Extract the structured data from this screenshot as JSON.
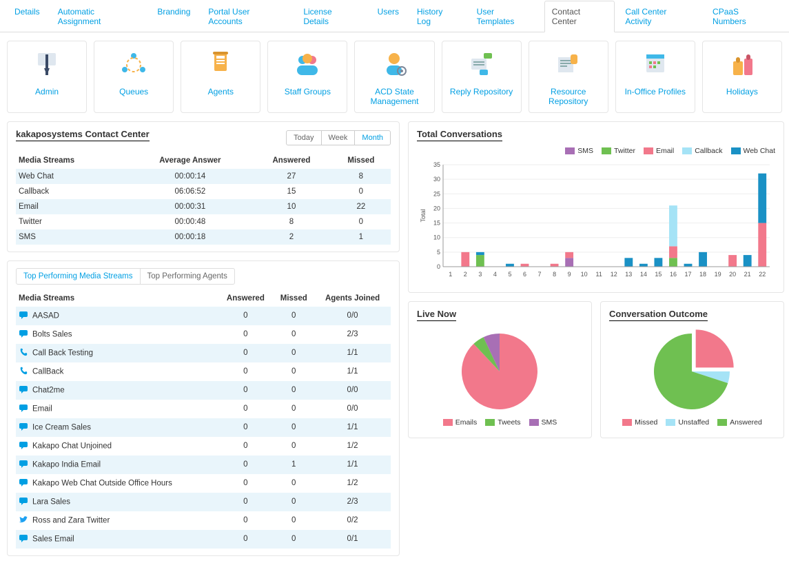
{
  "topTabs": [
    "Details",
    "Automatic Assignment",
    "Branding",
    "Portal User Accounts",
    "License Details",
    "Users",
    "History Log",
    "User Templates",
    "Contact Center",
    "Call Center Activity",
    "CPaaS Numbers"
  ],
  "topActive": 8,
  "cards": [
    {
      "label": "Admin",
      "icon": "admin"
    },
    {
      "label": "Queues",
      "icon": "queues"
    },
    {
      "label": "Agents",
      "icon": "agents"
    },
    {
      "label": "Staff Groups",
      "icon": "staff-groups"
    },
    {
      "label": "ACD State Management",
      "icon": "acd"
    },
    {
      "label": "Reply Repository",
      "icon": "reply-repo"
    },
    {
      "label": "Resource Repository",
      "icon": "resource-repo"
    },
    {
      "label": "In-Office Profiles",
      "icon": "profiles"
    },
    {
      "label": "Holidays",
      "icon": "holidays"
    }
  ],
  "summary": {
    "title": "kakaposystems Contact Center",
    "range": {
      "options": [
        "Today",
        "Week",
        "Month"
      ],
      "active": 2
    },
    "headers": [
      "Media Streams",
      "Average Answer",
      "Answered",
      "Missed"
    ],
    "rows": [
      {
        "name": "Web Chat",
        "avg": "00:00:14",
        "ans": "27",
        "miss": "8"
      },
      {
        "name": "Callback",
        "avg": "06:06:52",
        "ans": "15",
        "miss": "0"
      },
      {
        "name": "Email",
        "avg": "00:00:31",
        "ans": "10",
        "miss": "22"
      },
      {
        "name": "Twitter",
        "avg": "00:00:48",
        "ans": "8",
        "miss": "0"
      },
      {
        "name": "SMS",
        "avg": "00:00:18",
        "ans": "2",
        "miss": "1"
      }
    ]
  },
  "subtabs": {
    "options": [
      "Top Performing Media Streams",
      "Top Performing Agents"
    ],
    "active": 0
  },
  "perf": {
    "headers": [
      "Media Streams",
      "Answered",
      "Missed",
      "Agents Joined"
    ],
    "rows": [
      {
        "icon": "chat",
        "color": "#009fe3",
        "name": "AASAD",
        "ans": "0",
        "miss": "0",
        "aj": "0/0"
      },
      {
        "icon": "chat",
        "color": "#009fe3",
        "name": "Bolts Sales",
        "ans": "0",
        "miss": "0",
        "aj": "2/3"
      },
      {
        "icon": "phone",
        "color": "#009fe3",
        "name": "Call Back Testing",
        "ans": "0",
        "miss": "0",
        "aj": "1/1"
      },
      {
        "icon": "phone",
        "color": "#009fe3",
        "name": "CallBack",
        "ans": "0",
        "miss": "0",
        "aj": "1/1"
      },
      {
        "icon": "chat",
        "color": "#009fe3",
        "name": "Chat2me",
        "ans": "0",
        "miss": "0",
        "aj": "0/0"
      },
      {
        "icon": "chat",
        "color": "#009fe3",
        "name": "Email",
        "ans": "0",
        "miss": "0",
        "aj": "0/0"
      },
      {
        "icon": "chat",
        "color": "#009fe3",
        "name": "Ice Cream Sales",
        "ans": "0",
        "miss": "0",
        "aj": "1/1"
      },
      {
        "icon": "chat",
        "color": "#009fe3",
        "name": "Kakapo Chat Unjoined",
        "ans": "0",
        "miss": "0",
        "aj": "1/2"
      },
      {
        "icon": "chat",
        "color": "#009fe3",
        "name": "Kakapo India Email",
        "ans": "0",
        "miss": "1",
        "aj": "1/1"
      },
      {
        "icon": "chat",
        "color": "#009fe3",
        "name": "Kakapo Web Chat Outside Office Hours",
        "ans": "0",
        "miss": "0",
        "aj": "1/2"
      },
      {
        "icon": "chat",
        "color": "#009fe3",
        "name": "Lara Sales",
        "ans": "0",
        "miss": "0",
        "aj": "2/3"
      },
      {
        "icon": "twitter",
        "color": "#1da1f2",
        "name": "Ross and Zara Twitter",
        "ans": "0",
        "miss": "0",
        "aj": "0/2"
      },
      {
        "icon": "chat",
        "color": "#009fe3",
        "name": "Sales Email",
        "ans": "0",
        "miss": "0",
        "aj": "0/1"
      }
    ]
  },
  "colors": {
    "pink": "#f2788b",
    "green": "#6fc051",
    "cyan": "#a5e3f6",
    "blue": "#1a91c5",
    "purple": "#a86fb5"
  },
  "totalConv": {
    "title": "Total Conversations",
    "legend": [
      "SMS",
      "Twitter",
      "Email",
      "Callback",
      "Web Chat"
    ],
    "legendColors": [
      "#a86fb5",
      "#6fc051",
      "#f2788b",
      "#a5e3f6",
      "#1a91c5"
    ],
    "yLabel": "Total"
  },
  "liveNow": {
    "title": "Live Now",
    "legend": [
      "Emails",
      "Tweets",
      "SMS"
    ],
    "legendColors": [
      "#f2788b",
      "#6fc051",
      "#a86fb5"
    ]
  },
  "outcome": {
    "title": "Conversation Outcome",
    "legend": [
      "Missed",
      "Unstaffed",
      "Answered"
    ],
    "legendColors": [
      "#f2788b",
      "#a5e3f6",
      "#6fc051"
    ]
  },
  "chart_data": [
    {
      "id": "total_conversations",
      "type": "bar",
      "stacked": true,
      "title": "Total Conversations",
      "xlabel": "",
      "ylabel": "Total",
      "ylim": [
        0,
        35
      ],
      "yticks": [
        0,
        5,
        10,
        15,
        20,
        25,
        30,
        35
      ],
      "categories": [
        "1",
        "2",
        "3",
        "4",
        "5",
        "6",
        "7",
        "8",
        "9",
        "10",
        "11",
        "12",
        "13",
        "14",
        "15",
        "16",
        "17",
        "18",
        "19",
        "20",
        "21",
        "22"
      ],
      "series": [
        {
          "name": "SMS",
          "color": "#a86fb5",
          "values": [
            0,
            0,
            0,
            0,
            0,
            0,
            0,
            0,
            3,
            0,
            0,
            0,
            0,
            0,
            0,
            0,
            0,
            0,
            0,
            0,
            0,
            0
          ]
        },
        {
          "name": "Twitter",
          "color": "#6fc051",
          "values": [
            0,
            0,
            4,
            0,
            0,
            0,
            0,
            0,
            0,
            0,
            0,
            0,
            0,
            0,
            0,
            3,
            0,
            0,
            0,
            0,
            0,
            0
          ]
        },
        {
          "name": "Email",
          "color": "#f2788b",
          "values": [
            0,
            5,
            0,
            0,
            0,
            1,
            0,
            1,
            2,
            0,
            0,
            0,
            0,
            0,
            0,
            4,
            0,
            0,
            0,
            4,
            0,
            15
          ]
        },
        {
          "name": "Callback",
          "color": "#a5e3f6",
          "values": [
            0,
            0,
            0,
            0,
            0,
            0,
            0,
            0,
            0,
            0,
            0,
            0,
            0,
            0,
            0,
            14,
            0,
            0,
            0,
            0,
            0,
            0
          ]
        },
        {
          "name": "Web Chat",
          "color": "#1a91c5",
          "values": [
            0,
            0,
            1,
            0,
            1,
            0,
            0,
            0,
            0,
            0,
            0,
            0,
            3,
            1,
            3,
            0,
            1,
            5,
            0,
            0,
            4,
            17
          ]
        }
      ]
    },
    {
      "id": "live_now",
      "type": "pie",
      "title": "Live Now",
      "series": [
        {
          "name": "Emails",
          "color": "#f2788b",
          "value": 88
        },
        {
          "name": "Tweets",
          "color": "#6fc051",
          "value": 5
        },
        {
          "name": "SMS",
          "color": "#a86fb5",
          "value": 7
        }
      ]
    },
    {
      "id": "conversation_outcome",
      "type": "pie",
      "title": "Conversation Outcome",
      "series": [
        {
          "name": "Missed",
          "color": "#f2788b",
          "value": 25
        },
        {
          "name": "Unstaffed",
          "color": "#a5e3f6",
          "value": 5
        },
        {
          "name": "Answered",
          "color": "#6fc051",
          "value": 70
        }
      ]
    }
  ]
}
